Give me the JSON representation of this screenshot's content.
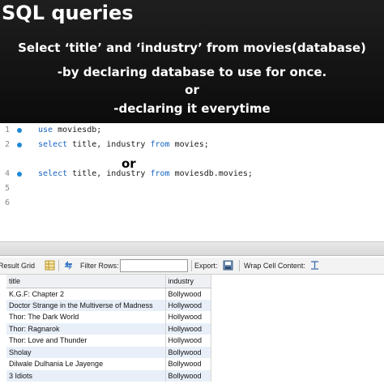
{
  "banner": {
    "title": "SQL queries",
    "line1": "Select ‘title’ and ‘industry’ from movies(database)",
    "line2": "-by declaring database to use for once.",
    "line3": "or",
    "line4": "-declaring it everytime"
  },
  "editor": {
    "lines": [
      {
        "num": "1",
        "kw": "use",
        "rest": " moviesdb;"
      },
      {
        "num": "2",
        "kw": "select",
        "mid": " title, industry ",
        "kw2": "from",
        "rest": " movies;"
      },
      {
        "num": "4",
        "kw": "select",
        "mid": " title, industry ",
        "kw2": "from",
        "rest": " moviesdb.movies;"
      },
      {
        "num": "5"
      },
      {
        "num": "6"
      }
    ],
    "or_label": "or",
    "marker_color": "#1e88d8"
  },
  "toolbar": {
    "result_grid": "Result Grid",
    "filter_rows": "Filter Rows:",
    "export": "Export:",
    "wrap": "Wrap Cell Content:"
  },
  "results": {
    "columns": [
      "title",
      "industry"
    ],
    "rows": [
      [
        "K.G.F: Chapter 2",
        "Bollywood"
      ],
      [
        "Doctor Strange in the Multiverse of Madness",
        "Hollywood"
      ],
      [
        "Thor: The Dark World",
        "Hollywood"
      ],
      [
        "Thor: Ragnarok",
        "Hollywood"
      ],
      [
        "Thor: Love and Thunder",
        "Hollywood"
      ],
      [
        "Sholay",
        "Bollywood"
      ],
      [
        "Dilwale Dulhania Le Jayenge",
        "Bollywood"
      ],
      [
        "3 Idiots",
        "Bollywood"
      ]
    ]
  }
}
